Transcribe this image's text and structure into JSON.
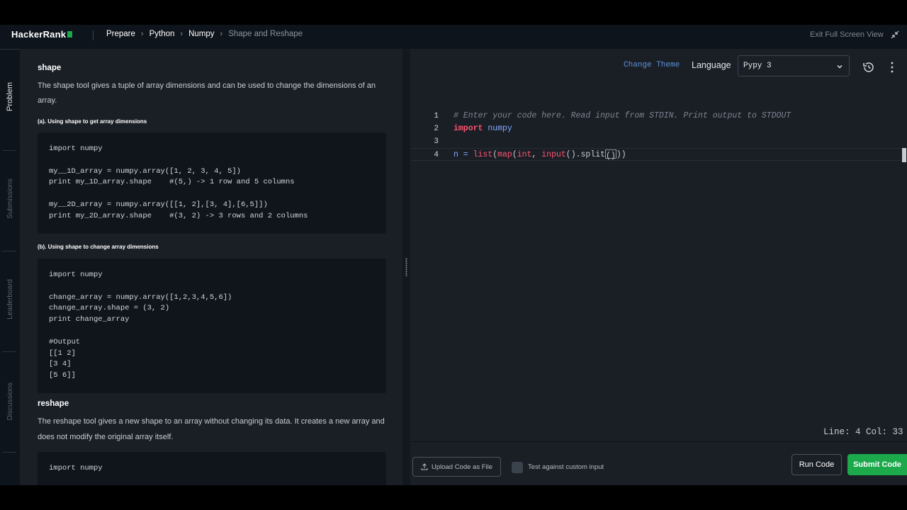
{
  "app": {
    "logo": "HackerRank",
    "exit_fullscreen": "Exit Full Screen View"
  },
  "breadcrumb": [
    "Prepare",
    "Python",
    "Numpy",
    "Shape and Reshape"
  ],
  "sidetabs": [
    "Problem",
    "Submissions",
    "Leaderboard",
    "Discussions"
  ],
  "problem": {
    "shape_heading": "shape",
    "shape_desc_1": "The shape tool gives a tuple of array dimensions and can be used to change the dimensions of an",
    "shape_desc_2": "array.",
    "sub_a": "(a). Using shape to get array dimensions",
    "code_a": [
      "import numpy",
      "",
      "my__1D_array = numpy.array([1, 2, 3, 4, 5])",
      "print my_1D_array.shape    #(5,) -> 1 row and 5 columns",
      "",
      "my__2D_array = numpy.array([[1, 2],[3, 4],[6,5]])",
      "print my_2D_array.shape    #(3, 2) -> 3 rows and 2 columns"
    ],
    "sub_b": "(b). Using shape to change array dimensions",
    "code_b": [
      "import numpy",
      "",
      "change_array = numpy.array([1,2,3,4,5,6])",
      "change_array.shape = (3, 2)",
      "print change_array",
      "",
      "#Output",
      "[[1 2]",
      "[3 4]",
      "[5 6]]"
    ],
    "reshape_heading": "reshape",
    "reshape_desc_1": "The reshape tool gives a new shape to an array without changing its data. It creates a new array and",
    "reshape_desc_2": "does not modify the original array itself.",
    "code_c": [
      "import numpy"
    ]
  },
  "editor": {
    "change_theme": "Change Theme",
    "language_label": "Language",
    "language_value": "Pypy 3",
    "lines": [
      {
        "num": "1",
        "comment": "# Enter your code here. Read input from STDIN. Print output to STDOUT"
      },
      {
        "num": "2",
        "kw": "import",
        "name": "numpy"
      },
      {
        "num": "3"
      },
      {
        "num": "4",
        "pre": "n = ",
        "f1": "list",
        "p1": "(",
        "f2": "map",
        "p2": "(",
        "f3": "int",
        "p3": ", ",
        "f4": "input",
        "p4": "().split",
        "cursor": "()",
        "post": "))"
      }
    ],
    "status": "Line: 4 Col: 33"
  },
  "bottom": {
    "upload": "Upload Code as File",
    "custom_input": "Test against custom input",
    "run": "Run Code",
    "submit": "Submit Code"
  },
  "colors": {
    "accent_green": "#1ba94c",
    "link_blue": "#5e90d8",
    "keyword_red": "#ff5370",
    "name_blue": "#82aaff"
  }
}
